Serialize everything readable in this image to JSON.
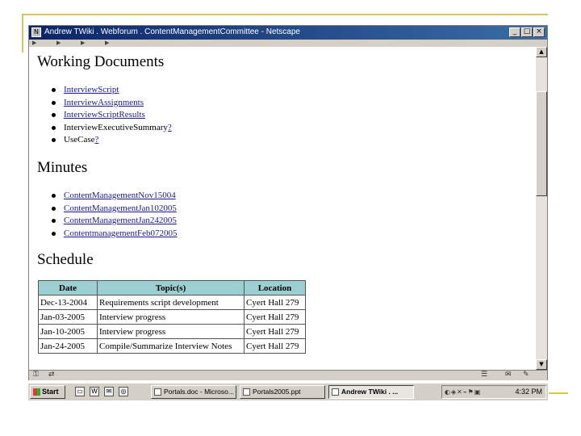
{
  "window": {
    "title": "Andrew TWiki . Webforum . ContentManagementCommittee - Netscape",
    "app_icon": "netscape-icon",
    "controls": [
      "_",
      "□",
      "×"
    ]
  },
  "sections": {
    "working": {
      "heading": "Working Documents",
      "items": [
        {
          "label": "InterviewScript"
        },
        {
          "label": "InterviewAssignments"
        },
        {
          "label": "InterviewScriptResults"
        },
        {
          "label": "InterviewExecutiveSummary",
          "suffix": "?"
        },
        {
          "label": "UseCase",
          "suffix": "?"
        }
      ]
    },
    "minutes": {
      "heading": "Minutes",
      "items": [
        {
          "label": "ContentManagementNov15004"
        },
        {
          "label": "ContentManagementJan102005"
        },
        {
          "label": "ContentManagementJan242005"
        },
        {
          "label": "ContentmanagementFeb072005"
        }
      ]
    },
    "schedule": {
      "heading": "Schedule",
      "columns": [
        "Date",
        "Topic(s)",
        "Location"
      ],
      "rows": [
        [
          "Dec-13-2004",
          "Requirements script development",
          "Cyert Hall 279"
        ],
        [
          "Jan-03-2005",
          "Interview progress",
          "Cyert Hall 279"
        ],
        [
          "Jan-10-2005",
          "Interview progress",
          "Cyert Hall 279"
        ],
        [
          "Jan-24-2005",
          "Compile/Summarize Interview Notes",
          "Cyert Hall 279"
        ]
      ]
    }
  },
  "taskbar": {
    "start_label": "Start",
    "tasks": [
      {
        "label": "Portals.doc - Microso...",
        "active": false
      },
      {
        "label": "Portals2005.ppt",
        "active": false
      },
      {
        "label": "Andrew TWiki . ...",
        "active": true
      }
    ],
    "clock": "4:32 PM"
  },
  "colors": {
    "title_bar": "#0a246a",
    "table_header": "#9ccfd2",
    "link": "#1a1a8c",
    "slide_accent": "#d8c458"
  }
}
